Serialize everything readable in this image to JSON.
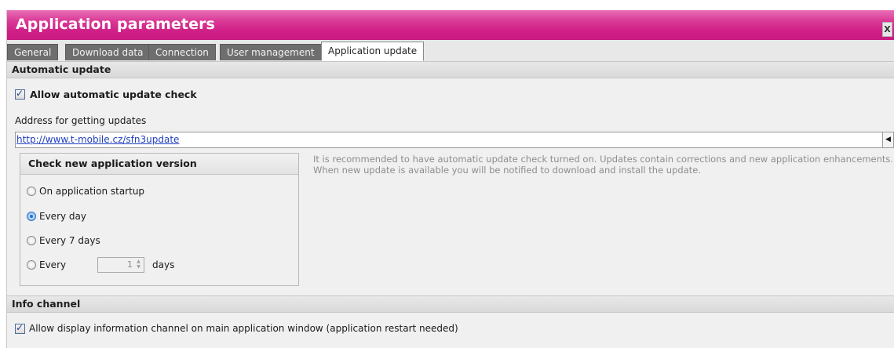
{
  "window": {
    "title": "Application parameters",
    "close_label": "X"
  },
  "tabs": [
    {
      "label": "General",
      "active": false
    },
    {
      "label": "Download data",
      "active": false
    },
    {
      "label": "Connection",
      "active": false
    },
    {
      "label": "User management",
      "active": false
    },
    {
      "label": "Application update",
      "active": true
    }
  ],
  "automatic_update": {
    "header": "Automatic update",
    "allow_check_label": "Allow automatic update check",
    "allow_check_checked": true,
    "address_label": "Address for getting updates",
    "address_value": "http://www.t-mobile.cz/sfn3update",
    "hint_line1": "It is recommended to have automatic update check turned on. Updates contain corrections and new application enhancements.",
    "hint_line2": "When new update is available you will be notified to download and install the update.",
    "check_group": {
      "title": "Check new application version",
      "options": [
        {
          "label": "On application startup",
          "selected": false
        },
        {
          "label": "Every day",
          "selected": true
        },
        {
          "label": "Every 7 days",
          "selected": false
        },
        {
          "label": "Every",
          "selected": false
        }
      ],
      "every_value": "1",
      "every_unit": "days"
    }
  },
  "info_channel": {
    "header": "Info channel",
    "allow_label": "Allow display information channel on main application window (application restart needed)",
    "allow_checked": true
  },
  "colors": {
    "title_bar": "#d02088",
    "link": "#1f3fbf",
    "hint_text": "#8d8d8d"
  }
}
